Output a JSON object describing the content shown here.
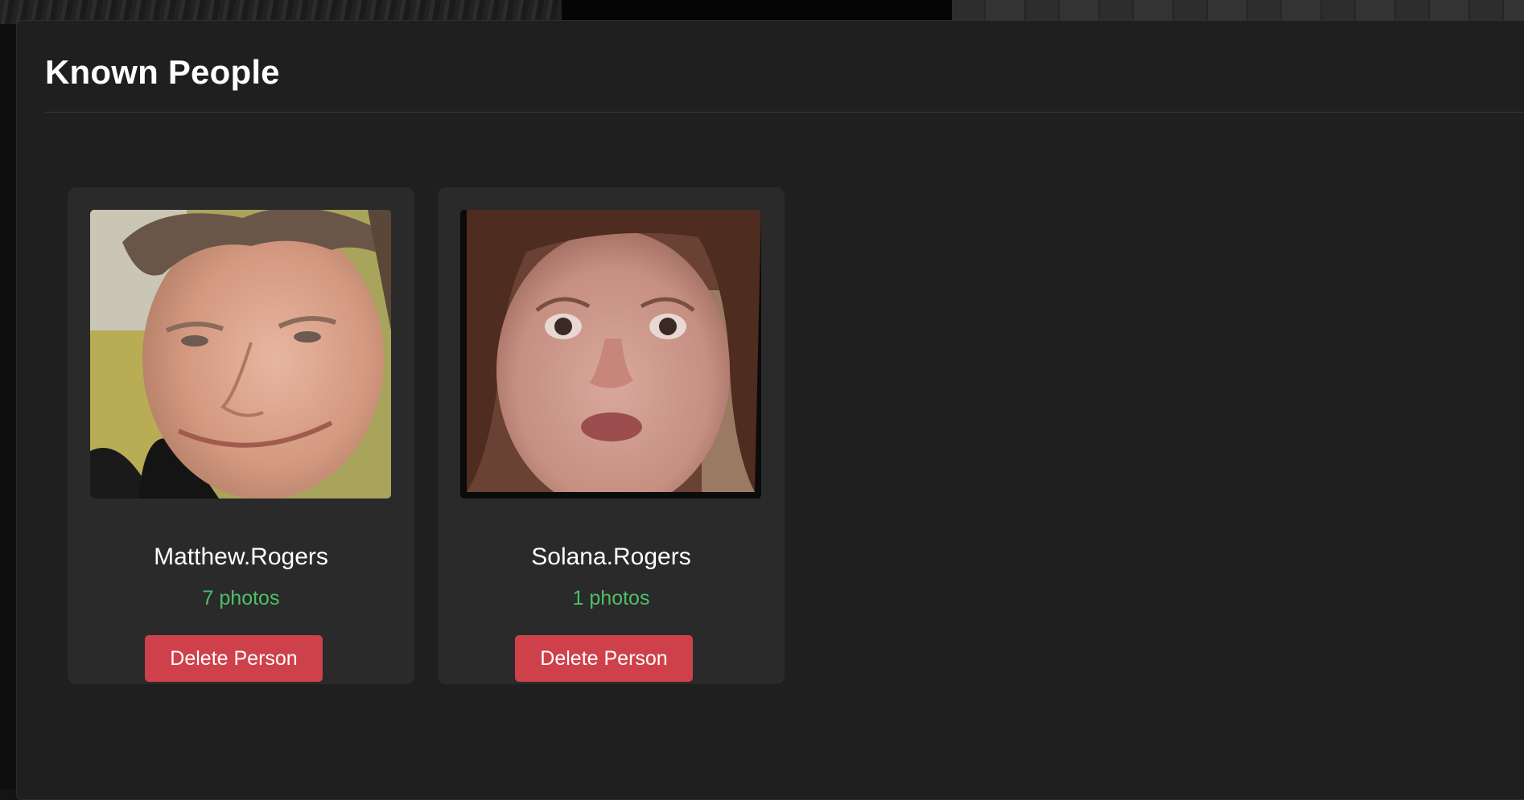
{
  "panel": {
    "title": "Known People"
  },
  "people": [
    {
      "name": "Matthew.Rogers",
      "photo_count": "7 photos",
      "delete_label": "Delete Person"
    },
    {
      "name": "Solana.Rogers",
      "photo_count": "1 photos",
      "delete_label": "Delete Person"
    }
  ],
  "colors": {
    "panel_background": "#1f1f1f",
    "card_background": "#2a2a2a",
    "photo_count_text": "#4fbf67",
    "delete_button": "#cf414a"
  }
}
